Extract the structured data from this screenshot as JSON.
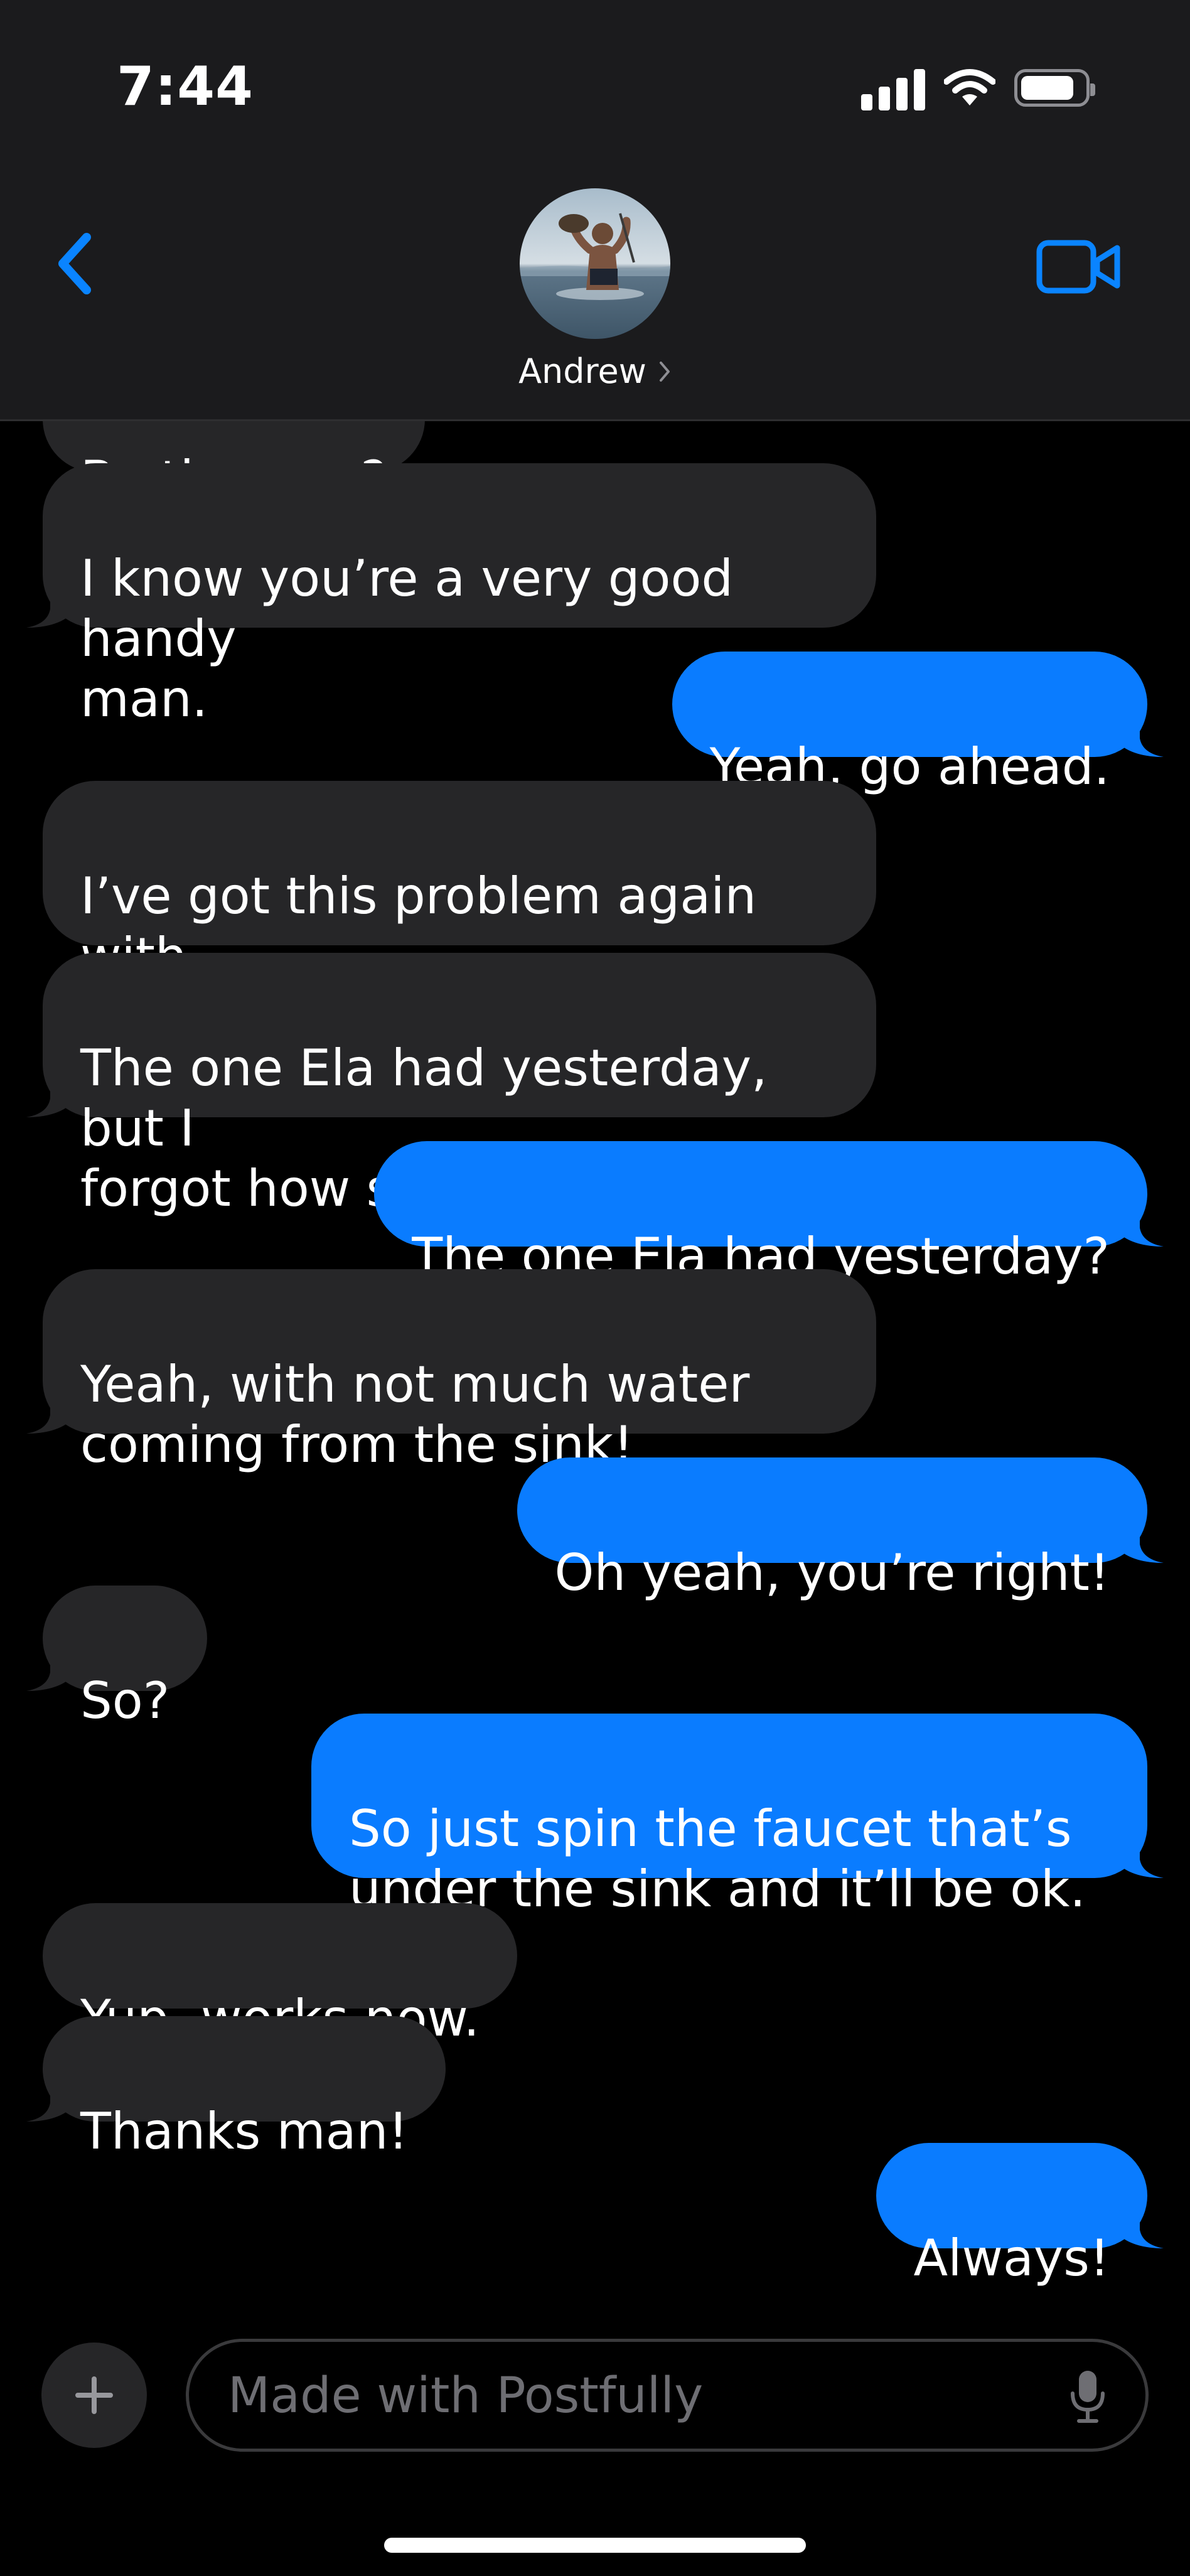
{
  "status_bar": {
    "time": "7:44",
    "battery_level": 0.85
  },
  "header": {
    "contact_name": "Andrew"
  },
  "messages": [
    {
      "direction": "in",
      "text": "By the way?"
    },
    {
      "direction": "in",
      "text": "I know you’re a very good handy\nman."
    },
    {
      "direction": "out",
      "text": "Yeah, go ahead."
    },
    {
      "direction": "in",
      "text": "I’ve got this problem again with\nthe kitchen sink, no pressure."
    },
    {
      "direction": "in",
      "text": "The one Ela had yesterday, but I\nforgot how she solved it."
    },
    {
      "direction": "out",
      "text": "The one Ela had yesterday?"
    },
    {
      "direction": "in",
      "text": "Yeah, with not much water\ncoming from the sink!"
    },
    {
      "direction": "out",
      "text": "Oh yeah, you’re right!"
    },
    {
      "direction": "in",
      "text": "So?"
    },
    {
      "direction": "out",
      "text": "So just spin the faucet that’s\nunder the sink and it’ll be ok."
    },
    {
      "direction": "in",
      "text": "Yup, works now."
    },
    {
      "direction": "in",
      "text": "Thanks man!"
    },
    {
      "direction": "out",
      "text": "Always!"
    }
  ],
  "composer": {
    "placeholder": "Made with Postfully"
  },
  "icons": {
    "back": "chevron-left-icon",
    "video": "video-camera-icon",
    "plus": "plus-icon",
    "mic": "microphone-icon",
    "signal": "cellular-signal-icon",
    "wifi": "wifi-icon",
    "battery": "battery-icon"
  },
  "colors": {
    "accent": "#0a7cff",
    "incoming_bubble": "#262628",
    "header_bg": "#1b1b1d",
    "background": "#000000"
  }
}
